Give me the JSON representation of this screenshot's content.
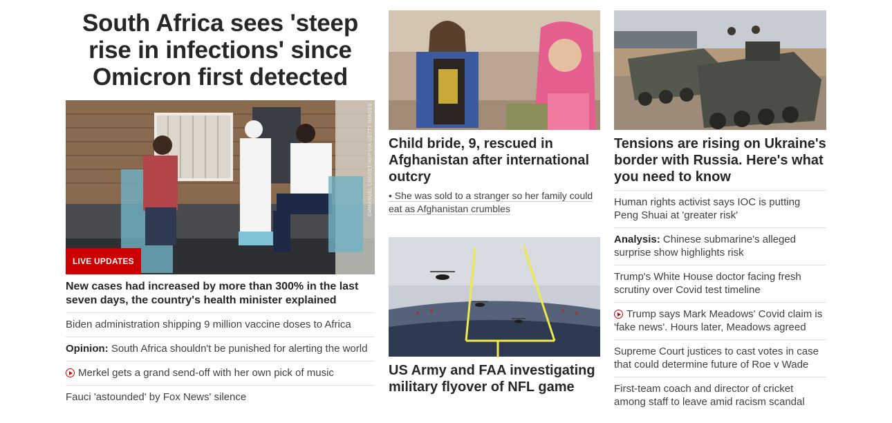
{
  "col1": {
    "headline": "South Africa sees 'steep rise in infections' since Omicron first detected",
    "photo_credit": "EMMANUEL CROSET/AFP VIA GETTY IMAGES",
    "badge": "LIVE UPDATES",
    "lead": "New cases had increased by more than 300% in the last seven days, the country's health minister explained",
    "list": [
      {
        "label": "",
        "text": "Biden administration shipping 9 million vaccine doses to Africa",
        "video": false
      },
      {
        "label": "Opinion:",
        "text": " South Africa shouldn't be punished for alerting the world",
        "video": false
      },
      {
        "label": "",
        "text": "Merkel gets a grand send-off with her own pick of music",
        "video": true
      },
      {
        "label": "",
        "text": "Fauci 'astounded' by Fox News' silence",
        "video": false
      }
    ]
  },
  "col2": {
    "story1": {
      "headline": "Child bride, 9, rescued in Afghanistan after international outcry",
      "bullet": "• She was sold to a stranger so her family could eat as Afghanistan crumbles"
    },
    "story2": {
      "headline": "US Army and FAA investigating military flyover of NFL game"
    }
  },
  "col3": {
    "headline": "Tensions are rising on Ukraine's border with Russia. Here's what you need to know",
    "list": [
      {
        "label": "",
        "text": "Human rights activist says IOC is putting Peng Shuai at 'greater risk'",
        "video": false
      },
      {
        "label": "Analysis:",
        "text": " Chinese submarine's alleged surprise show highlights risk",
        "video": false
      },
      {
        "label": "",
        "text": "Trump's White House doctor facing fresh scrutiny over Covid test timeline",
        "video": false
      },
      {
        "label": "",
        "text": "Trump says Mark Meadows' Covid claim is 'fake news'. Hours later, Meadows agreed",
        "video": true
      },
      {
        "label": "",
        "text": "Supreme Court justices to cast votes in case that could determine future of Roe v Wade",
        "video": false
      },
      {
        "label": "",
        "text": "First-team coach and director of cricket among staff to leave amid racism scandal",
        "video": false
      }
    ]
  }
}
